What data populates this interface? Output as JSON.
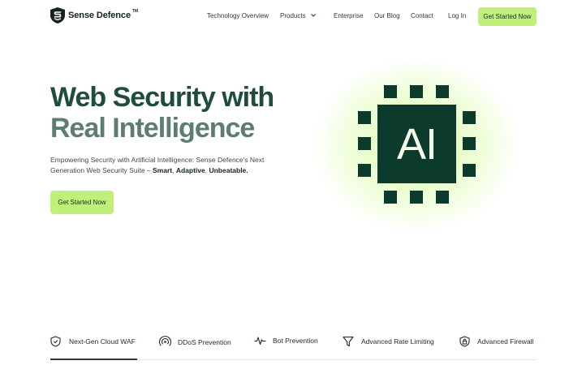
{
  "brand": {
    "name": "Sense Defence",
    "trademark": "TM"
  },
  "nav": {
    "items": [
      {
        "label": "Technology Overview"
      },
      {
        "label": "Products"
      },
      {
        "label": "Enterprise"
      },
      {
        "label": "Our Blog"
      },
      {
        "label": "Contact"
      },
      {
        "label": "Log In"
      }
    ],
    "cta_label": "Get Started Now"
  },
  "hero": {
    "title_line1": "Web Security with",
    "title_line2": "Real Intelligence",
    "description_prefix": "Empowering Security with Artificial Intelligence: Sense Defence's Next Generation Web Security Suite – ",
    "description_bold1": "Smart",
    "description_sep1": ", ",
    "description_bold2": "Adaptive",
    "description_sep2": ", ",
    "description_bold3": "Unbeatable.",
    "cta_label": "Get Started Now",
    "chip_text": "AI"
  },
  "features": {
    "tabs": [
      {
        "label": "Next-Gen Cloud WAF",
        "icon": "shield-icon"
      },
      {
        "label": "DDoS Prevention",
        "icon": "signal-icon"
      },
      {
        "label": "Bot Prevention",
        "icon": "pulse-icon"
      },
      {
        "label": "Advanced Rate Limiting",
        "icon": "funnel-icon"
      },
      {
        "label": "Advanced Firewall",
        "icon": "lock-icon"
      }
    ],
    "active_index": 0
  },
  "colors": {
    "accent": "#c0f07a",
    "primary_dark": "#0c3a2c",
    "title_dark": "#1f4c3d",
    "title_muted": "#5d7d6f"
  }
}
